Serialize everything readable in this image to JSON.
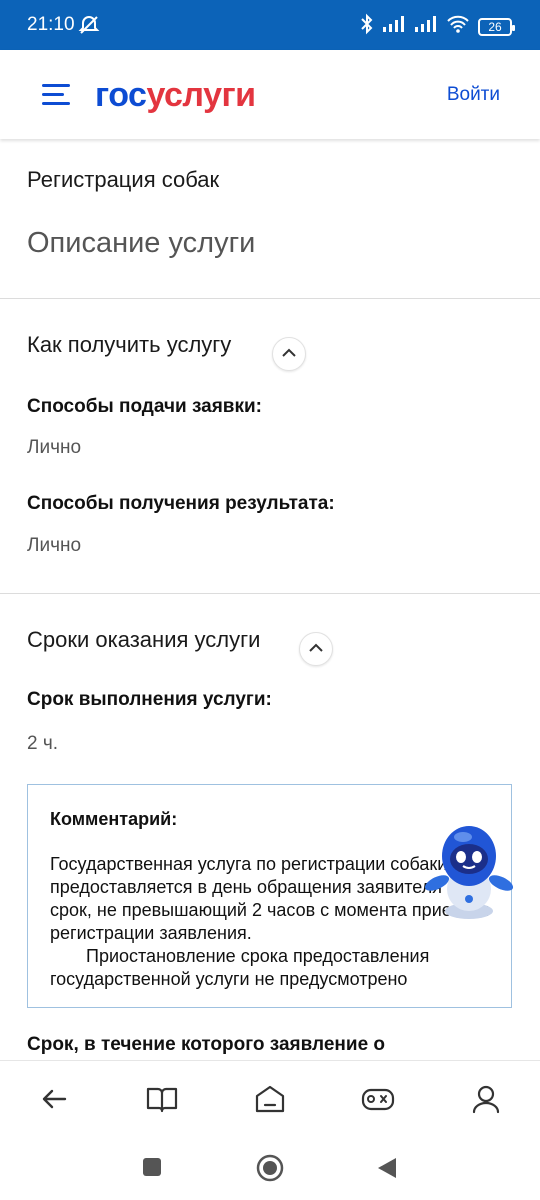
{
  "status_bar": {
    "time": "21:10",
    "battery": "26"
  },
  "header": {
    "logo_part1": "гос",
    "logo_part2": "услуги",
    "login": "Войти"
  },
  "page": {
    "breadcrumb": "Регистрация собак",
    "title": "Описание услуги"
  },
  "sections": [
    {
      "title": "Как получить услугу",
      "fields": [
        {
          "label": "Способы подачи заявки:",
          "value": "Лично"
        },
        {
          "label": "Способы получения результата:",
          "value": "Лично"
        }
      ]
    },
    {
      "title": "Сроки оказания услуги",
      "fields": [
        {
          "label": "Срок выполнения услуги:",
          "value": "2 ч."
        }
      ]
    }
  ],
  "comment": {
    "title": "Комментарий:",
    "paragraph1": "Государственная услуга по регистрации собаки предоставляется в день обращения заявителя в срок, не превышающий 2 часов с момента приема и регистрации заявления.",
    "paragraph2": "Приостановление срока предоставления государственной услуги не предусмотрено"
  },
  "next_label": "Срок, в течение которого заявление о",
  "icons": {
    "bottom_nav": [
      "back-arrow-icon",
      "book-icon",
      "home-icon",
      "gamepad-icon",
      "profile-icon"
    ],
    "system_nav": [
      "recent-apps-icon",
      "home-circle-icon",
      "back-triangle-icon"
    ]
  },
  "colors": {
    "status_bar": "#0c63b8",
    "brand_blue": "#0d4cd3",
    "brand_red": "#e3353f",
    "comment_border": "#9fc1e0"
  }
}
